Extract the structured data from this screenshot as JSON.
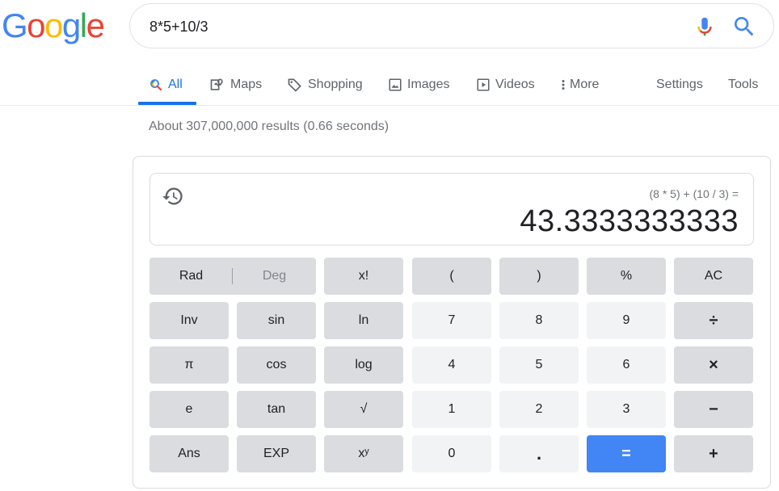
{
  "logo": {
    "letters": [
      "G",
      "o",
      "o",
      "g",
      "l",
      "e"
    ],
    "colors": [
      "#4285f4",
      "#ea4335",
      "#fbbc05",
      "#4285f4",
      "#34a853",
      "#ea4335"
    ]
  },
  "search": {
    "query": "8*5+10/3"
  },
  "tabs": [
    {
      "label": "All",
      "icon": "search-icon",
      "active": true
    },
    {
      "label": "Maps",
      "icon": "map-icon"
    },
    {
      "label": "Shopping",
      "icon": "tag-icon"
    },
    {
      "label": "Images",
      "icon": "image-icon"
    },
    {
      "label": "Videos",
      "icon": "play-icon"
    },
    {
      "label": "More",
      "icon": "more-vertical-icon"
    },
    {
      "label": "Settings"
    },
    {
      "label": "Tools"
    }
  ],
  "result_stats": "About 307,000,000 results (0.66 seconds)",
  "calculator": {
    "expression": "(8 * 5) + (10 / 3) =",
    "result": "43.3333333333",
    "rad_label": "Rad",
    "deg_label": "Deg",
    "keys": {
      "fact": "x!",
      "lparen": "(",
      "rparen": ")",
      "percent": "%",
      "ac": "AC",
      "inv": "Inv",
      "sin": "sin",
      "ln": "ln",
      "n7": "7",
      "n8": "8",
      "n9": "9",
      "div": "÷",
      "pi": "π",
      "cos": "cos",
      "log": "log",
      "n4": "4",
      "n5": "5",
      "n6": "6",
      "mul": "×",
      "e": "e",
      "tan": "tan",
      "sqrt": "√",
      "n1": "1",
      "n2": "2",
      "n3": "3",
      "sub": "−",
      "ans": "Ans",
      "exp": "EXP",
      "pow": "xʸ",
      "n0": "0",
      "dot": ".",
      "eq": "=",
      "add": "+"
    }
  },
  "colors": {
    "accent": "#1a73e8",
    "equals": "#4285f4",
    "key_fn": "#dadce0",
    "key_num": "#f1f3f4"
  }
}
